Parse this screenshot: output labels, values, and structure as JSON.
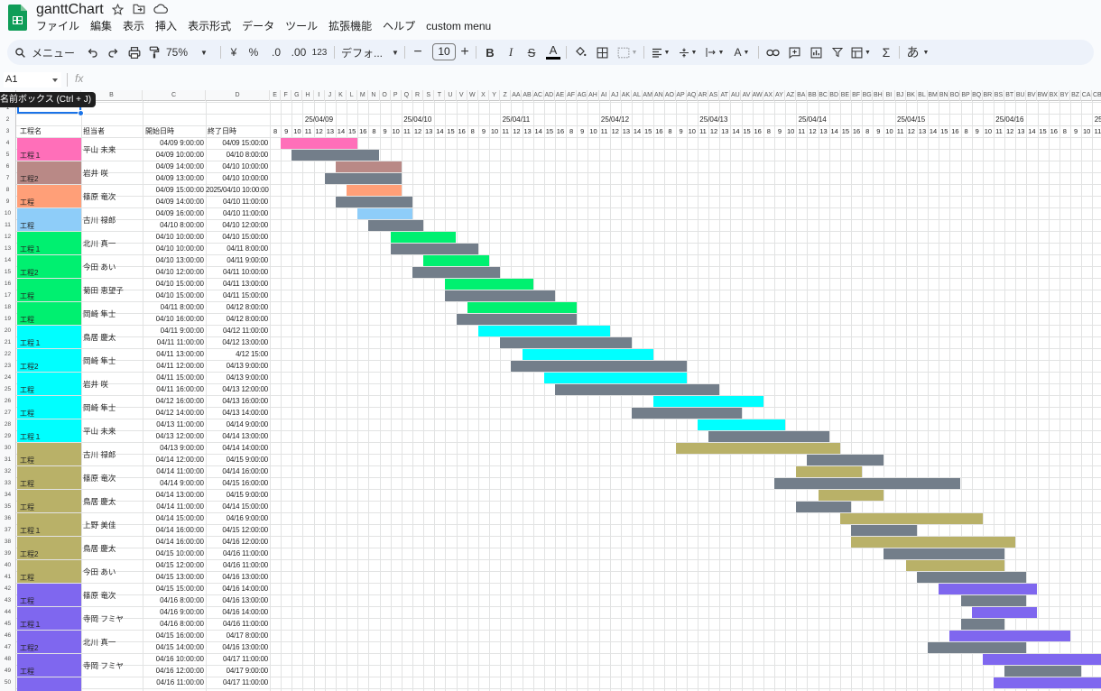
{
  "app": {
    "doc_title": "ganttChart",
    "menus": [
      "ファイル",
      "編集",
      "表示",
      "挿入",
      "表示形式",
      "データ",
      "ツール",
      "拡張機能",
      "ヘルプ",
      "custom menu"
    ]
  },
  "toolbar": {
    "search_label": "メニュー",
    "zoom": "75%",
    "currency": "¥",
    "percent": "%",
    "dec_dec": ".0",
    "dec_inc": ".00",
    "number_format": "123",
    "font": "デフォ...",
    "font_size": "10",
    "ime": "あ"
  },
  "formula_bar": {
    "cell": "A1",
    "fx": "fx"
  },
  "tooltip": "名前ボックス (Ctrl + J)",
  "hours": [
    "8",
    "9",
    "10",
    "11",
    "12",
    "13",
    "14",
    "15",
    "16"
  ],
  "dates": [
    "25/04/09",
    "25/04/10",
    "25/04/11",
    "25/04/12",
    "25/04/13",
    "25/04/14",
    "25/04/15",
    "25/04/16",
    "25"
  ],
  "col_letters": [
    "A",
    "B",
    "C",
    "D",
    "E",
    "F",
    "G",
    "H",
    "I",
    "J",
    "K",
    "L",
    "M",
    "N",
    "O",
    "P",
    "Q",
    "R",
    "S",
    "T",
    "U",
    "V",
    "W",
    "X",
    "Y",
    "Z",
    "AA",
    "AB",
    "AC",
    "AD",
    "AE",
    "AF",
    "AG",
    "AH",
    "AI",
    "AJ",
    "AK",
    "AL",
    "AM",
    "AN",
    "AO",
    "AP",
    "AQ",
    "AR",
    "AS",
    "AT",
    "AU",
    "AV",
    "AW",
    "AX",
    "AY",
    "AZ",
    "BA",
    "BB",
    "BC",
    "BD",
    "BE",
    "BF",
    "BG",
    "BH",
    "BI",
    "BJ",
    "BK",
    "BL",
    "BM",
    "BN",
    "BO",
    "BP",
    "BQ",
    "BR",
    "BS",
    "BT",
    "BU",
    "BV",
    "BW",
    "BX",
    "BY",
    "BZ",
    "CA",
    "CB"
  ],
  "headers": {
    "process": "工程名",
    "owner": "担当者",
    "start": "開始日時",
    "end": "終了日時"
  },
  "colors": {
    "pink": "#ff6fb9",
    "rose": "#b98986",
    "salmon": "#ff9f78",
    "sky": "#8ecdf9",
    "green": "#00f070",
    "cyan": "#00ffff",
    "olive": "#b9b168",
    "purple": "#7f67ef",
    "gray": "#737e8a"
  },
  "groups": [
    {
      "rows": [
        4,
        5
      ],
      "color": "pink",
      "label": "工程１",
      "owner": "平山 未来"
    },
    {
      "rows": [
        6,
        7
      ],
      "color": "rose",
      "label": "工程2",
      "owner": "岩井 咲"
    },
    {
      "rows": [
        8,
        9
      ],
      "color": "salmon",
      "label": "工程",
      "owner": "篠原 竜次"
    },
    {
      "rows": [
        10,
        11
      ],
      "color": "sky",
      "label": "工程",
      "owner": "古川 禄郎"
    },
    {
      "rows": [
        12,
        13
      ],
      "color": "green",
      "label": "工程１",
      "owner": "北川 真一"
    },
    {
      "rows": [
        14,
        15
      ],
      "color": "green",
      "label": "工程2",
      "owner": "今田 あい"
    },
    {
      "rows": [
        16,
        17
      ],
      "color": "green",
      "label": "工程",
      "owner": "菊田 恵望子"
    },
    {
      "rows": [
        18,
        19
      ],
      "color": "green",
      "label": "工程",
      "owner": "岡崎 隼士"
    },
    {
      "rows": [
        20,
        21
      ],
      "color": "cyan",
      "label": "工程１",
      "owner": "鳥居 慶太"
    },
    {
      "rows": [
        22,
        23
      ],
      "color": "cyan",
      "label": "工程2",
      "owner": "岡崎 隼士"
    },
    {
      "rows": [
        24,
        25
      ],
      "color": "cyan",
      "label": "工程",
      "owner": "岩井 咲"
    },
    {
      "rows": [
        26,
        27
      ],
      "color": "cyan",
      "label": "工程",
      "owner": "岡崎 隼士"
    },
    {
      "rows": [
        28,
        29
      ],
      "color": "cyan",
      "label": "工程１",
      "owner": "平山 未来"
    },
    {
      "rows": [
        30,
        31
      ],
      "color": "olive",
      "label": "工程",
      "owner": "古川 禄郎"
    },
    {
      "rows": [
        32,
        33
      ],
      "color": "olive",
      "label": "工程",
      "owner": "篠原 竜次"
    },
    {
      "rows": [
        34,
        35
      ],
      "color": "olive",
      "label": "工程",
      "owner": "鳥居 慶太"
    },
    {
      "rows": [
        36,
        37
      ],
      "color": "olive",
      "label": "工程１",
      "owner": "上野 美佳"
    },
    {
      "rows": [
        38,
        39
      ],
      "color": "olive",
      "label": "工程2",
      "owner": "鳥居 慶太"
    },
    {
      "rows": [
        40,
        41
      ],
      "color": "olive",
      "label": "工程",
      "owner": "今田 あい"
    },
    {
      "rows": [
        42,
        43
      ],
      "color": "purple",
      "label": "工程",
      "owner": "篠原 竜次"
    },
    {
      "rows": [
        44,
        45
      ],
      "color": "purple",
      "label": "工程１",
      "owner": "寺岡 フミヤ"
    },
    {
      "rows": [
        46,
        47
      ],
      "color": "purple",
      "label": "工程2",
      "owner": "北川 真一"
    },
    {
      "rows": [
        48,
        49
      ],
      "color": "purple",
      "label": "工程",
      "owner": "寺岡 フミヤ"
    },
    {
      "rows": [
        50,
        51
      ],
      "color": "purple",
      "label": "",
      "owner": ""
    }
  ],
  "tasks": [
    {
      "row": 4,
      "start": "04/09 9:00:00",
      "end": "04/09 15:00:00"
    },
    {
      "row": 5,
      "start": "04/09 10:00:00",
      "end": "04/10 8:00:00"
    },
    {
      "row": 6,
      "start": "04/09 14:00:00",
      "end": "04/10 10:00:00"
    },
    {
      "row": 7,
      "start": "04/09 13:00:00",
      "end": "04/10 10:00:00"
    },
    {
      "row": 8,
      "start": "04/09 15:00:00",
      "end": "2025/04/10 10:00:00"
    },
    {
      "row": 9,
      "start": "04/09 14:00:00",
      "end": "04/10 11:00:00"
    },
    {
      "row": 10,
      "start": "04/09 16:00:00",
      "end": "04/10 11:00:00"
    },
    {
      "row": 11,
      "start": "04/10 8:00:00",
      "end": "04/10 12:00:00"
    },
    {
      "row": 12,
      "start": "04/10 10:00:00",
      "end": "04/10 15:00:00"
    },
    {
      "row": 13,
      "start": "04/10 10:00:00",
      "end": "04/11 8:00:00"
    },
    {
      "row": 14,
      "start": "04/10 13:00:00",
      "end": "04/11 9:00:00"
    },
    {
      "row": 15,
      "start": "04/10 12:00:00",
      "end": "04/11 10:00:00"
    },
    {
      "row": 16,
      "start": "04/10 15:00:00",
      "end": "04/11 13:00:00"
    },
    {
      "row": 17,
      "start": "04/10 15:00:00",
      "end": "04/11 15:00:00"
    },
    {
      "row": 18,
      "start": "04/11 8:00:00",
      "end": "04/12 8:00:00"
    },
    {
      "row": 19,
      "start": "04/10 16:00:00",
      "end": "04/12 8:00:00"
    },
    {
      "row": 20,
      "start": "04/11 9:00:00",
      "end": "04/12 11:00:00"
    },
    {
      "row": 21,
      "start": "04/11 11:00:00",
      "end": "04/12 13:00:00"
    },
    {
      "row": 22,
      "start": "04/11 13:00:00",
      "end": "4/12 15:00"
    },
    {
      "row": 23,
      "start": "04/11 12:00:00",
      "end": "04/13 9:00:00"
    },
    {
      "row": 24,
      "start": "04/11 15:00:00",
      "end": "04/13 9:00:00"
    },
    {
      "row": 25,
      "start": "04/11 16:00:00",
      "end": "04/13 12:00:00"
    },
    {
      "row": 26,
      "start": "04/12 16:00:00",
      "end": "04/13 16:00:00"
    },
    {
      "row": 27,
      "start": "04/12 14:00:00",
      "end": "04/13 14:00:00"
    },
    {
      "row": 28,
      "start": "04/13 11:00:00",
      "end": "04/14 9:00:00"
    },
    {
      "row": 29,
      "start": "04/13 12:00:00",
      "end": "04/14 13:00:00"
    },
    {
      "row": 30,
      "start": "04/13 9:00:00",
      "end": "04/14 14:00:00"
    },
    {
      "row": 31,
      "start": "04/14 12:00:00",
      "end": "04/15 9:00:00"
    },
    {
      "row": 32,
      "start": "04/14 11:00:00",
      "end": "04/14 16:00:00"
    },
    {
      "row": 33,
      "start": "04/14 9:00:00",
      "end": "04/15 16:00:00"
    },
    {
      "row": 34,
      "start": "04/14 13:00:00",
      "end": "04/15 9:00:00"
    },
    {
      "row": 35,
      "start": "04/14 11:00:00",
      "end": "04/14 15:00:00"
    },
    {
      "row": 36,
      "start": "04/14 15:00:00",
      "end": "04/16 9:00:00"
    },
    {
      "row": 37,
      "start": "04/14 16:00:00",
      "end": "04/15 12:00:00"
    },
    {
      "row": 38,
      "start": "04/14 16:00:00",
      "end": "04/16 12:00:00"
    },
    {
      "row": 39,
      "start": "04/15 10:00:00",
      "end": "04/16 11:00:00"
    },
    {
      "row": 40,
      "start": "04/15 12:00:00",
      "end": "04/16 11:00:00"
    },
    {
      "row": 41,
      "start": "04/15 13:00:00",
      "end": "04/16 13:00:00"
    },
    {
      "row": 42,
      "start": "04/15 15:00:00",
      "end": "04/16 14:00:00"
    },
    {
      "row": 43,
      "start": "04/16 8:00:00",
      "end": "04/16 13:00:00"
    },
    {
      "row": 44,
      "start": "04/16 9:00:00",
      "end": "04/16 14:00:00"
    },
    {
      "row": 45,
      "start": "04/16 8:00:00",
      "end": "04/16 11:00:00"
    },
    {
      "row": 46,
      "start": "04/15 16:00:00",
      "end": "04/17 8:00:00"
    },
    {
      "row": 47,
      "start": "04/15 14:00:00",
      "end": "04/16 13:00:00"
    },
    {
      "row": 48,
      "start": "04/16 10:00:00",
      "end": "04/17 11:00:00"
    },
    {
      "row": 49,
      "start": "04/16 12:00:00",
      "end": "04/17 9:00:00"
    },
    {
      "row": 50,
      "start": "04/16 11:00:00",
      "end": "04/17 11:00:00"
    }
  ]
}
